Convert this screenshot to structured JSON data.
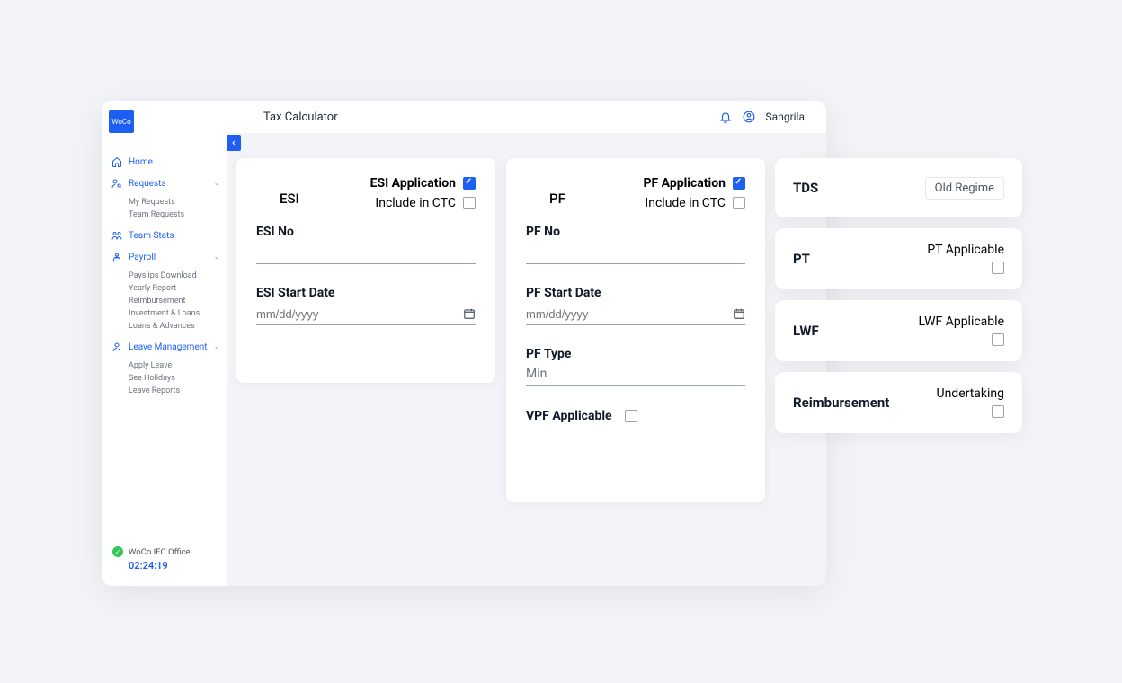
{
  "logo_text": "WoCo",
  "header": {
    "title": "Tax Calculator",
    "username": "Sangrila"
  },
  "sidebar": {
    "home": "Home",
    "requests": {
      "label": "Requests",
      "items": [
        "My Requests",
        "Team Requests"
      ]
    },
    "teamstats": "Team Stats",
    "payroll": {
      "label": "Payroll",
      "items": [
        "Payslips Download",
        "Yearly Report",
        "Reimbursement",
        "Investment & Loans",
        "Loans & Advances"
      ]
    },
    "leave": {
      "label": "Leave Management",
      "items": [
        "Apply Leave",
        "See Holidays",
        "Leave Reports"
      ]
    },
    "office": "WoCo IFC Office",
    "clock": "02:24:19"
  },
  "esi": {
    "name": "ESI",
    "app_label": "ESI Application",
    "include_label": "Include in CTC",
    "app_checked": true,
    "include_checked": false,
    "no_label": "ESI No",
    "no_value": "",
    "date_label": "ESI Start Date",
    "date_placeholder": "mm/dd/yyyy"
  },
  "pf": {
    "name": "PF",
    "app_label": "PF Application",
    "include_label": "Include in CTC",
    "app_checked": true,
    "include_checked": false,
    "no_label": "PF No",
    "no_value": "",
    "date_label": "PF Start Date",
    "date_placeholder": "mm/dd/yyyy",
    "type_label": "PF Type",
    "type_value": "Min",
    "vpf_label": "VPF Applicable",
    "vpf_checked": false
  },
  "side": {
    "tds": {
      "title": "TDS",
      "regime": "Old Regime"
    },
    "pt": {
      "title": "PT",
      "label": "PT Applicable",
      "checked": false
    },
    "lwf": {
      "title": "LWF",
      "label": "LWF Applicable",
      "checked": false
    },
    "reimb": {
      "title": "Reimbursement",
      "label": "Undertaking",
      "checked": false
    }
  }
}
